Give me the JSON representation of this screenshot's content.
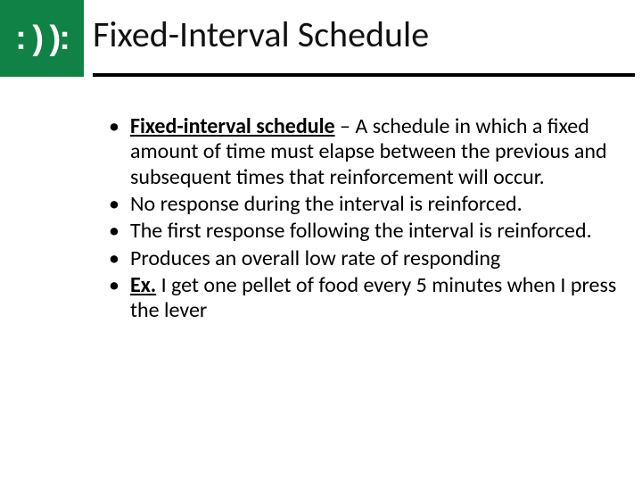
{
  "logo_text": ": ) ):",
  "title": "Fixed-Interval Schedule",
  "bullets": [
    {
      "term": "Fixed-interval schedule",
      "sep": " – ",
      "rest": "A schedule in which a fixed amount of time must elapse between the previous and subsequent times that reinforcement will occur."
    },
    {
      "rest": "No response during the interval is reinforced."
    },
    {
      "rest": "The first response following the interval is reinforced."
    },
    {
      "rest": "Produces an overall low rate of responding"
    },
    {
      "ex": "Ex.",
      "rest": " I get one pellet of food every 5 minutes when I press the lever"
    }
  ]
}
